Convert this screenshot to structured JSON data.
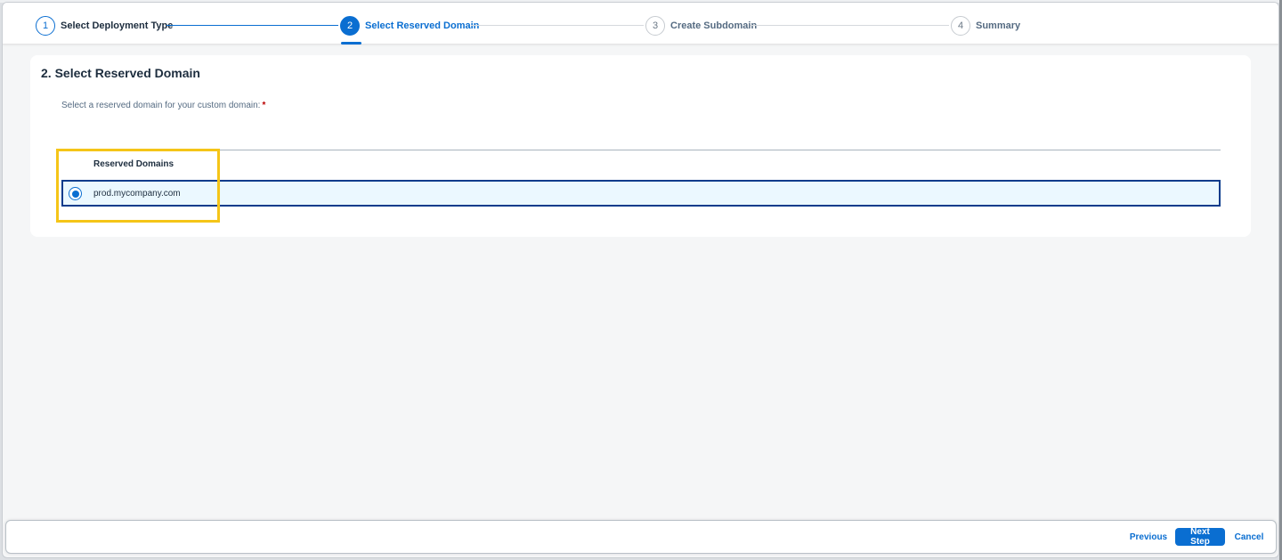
{
  "wizard": {
    "steps": [
      {
        "number": "1",
        "label": "Select Deployment Type",
        "state": "done"
      },
      {
        "number": "2",
        "label": "Select Reserved Domain",
        "state": "active"
      },
      {
        "number": "3",
        "label": "Create Subdomain",
        "state": "todo"
      },
      {
        "number": "4",
        "label": "Summary",
        "state": "todo"
      }
    ]
  },
  "main": {
    "title": "2. Select Reserved Domain",
    "field_label": "Select a reserved domain for your custom domain:",
    "required_marker": "*",
    "table": {
      "column_header": "Reserved Domains",
      "rows": [
        {
          "value": "prod.mycompany.com",
          "selected": true
        }
      ]
    }
  },
  "footer": {
    "previous_label": "Previous",
    "next_label": "Next Step",
    "cancel_label": "Cancel"
  },
  "colors": {
    "accent": "#0a6ed1",
    "highlight": "#f5c518",
    "selected_row_bg": "#ebf8ff"
  }
}
